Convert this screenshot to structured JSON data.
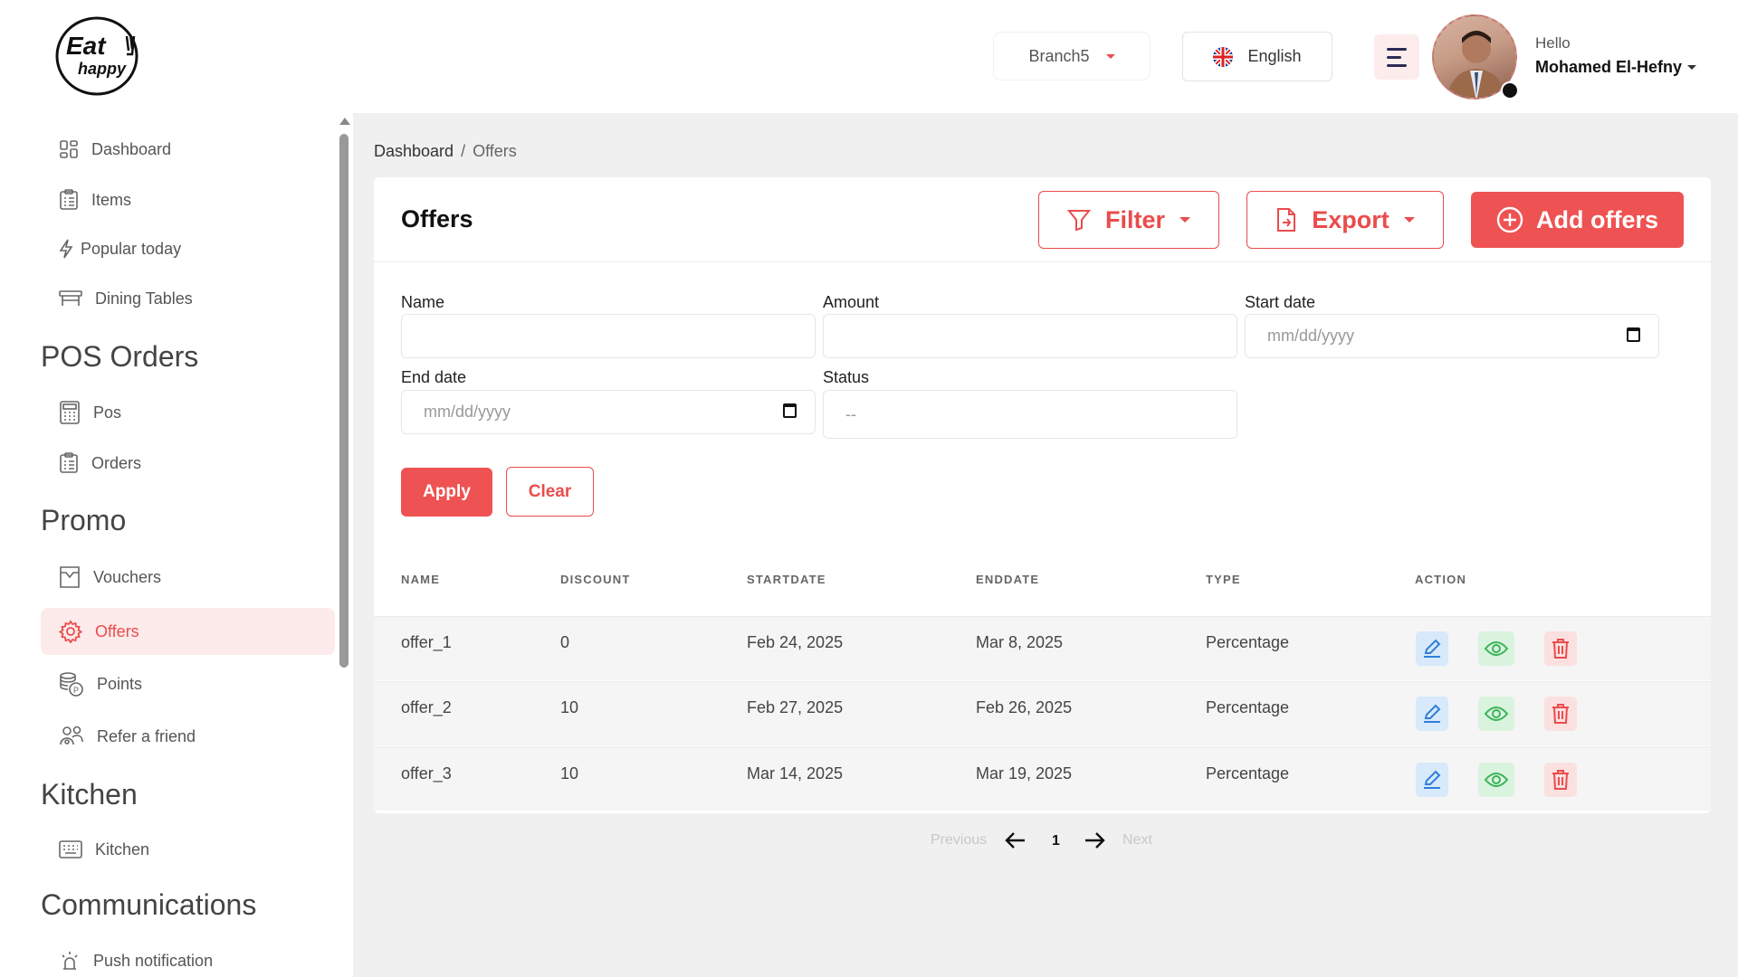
{
  "brand": {
    "logo_line1": "Eat",
    "logo_line2": "happy"
  },
  "header": {
    "branch": "Branch5",
    "language": "English",
    "greeting": "Hello",
    "user_name": "Mohamed El-Hefny"
  },
  "sidebar": {
    "items_top": [
      {
        "label": "Dashboard",
        "icon": "dashboard-icon"
      },
      {
        "label": "Items",
        "icon": "list-icon"
      },
      {
        "label": "Popular today",
        "icon": "lightning-icon"
      },
      {
        "label": "Dining Tables",
        "icon": "table-icon"
      }
    ],
    "sections": [
      {
        "title": "POS Orders",
        "items": [
          {
            "label": "Pos",
            "icon": "calculator-icon"
          },
          {
            "label": "Orders",
            "icon": "list-icon"
          }
        ]
      },
      {
        "title": "Promo",
        "items": [
          {
            "label": "Vouchers",
            "icon": "voucher-icon"
          },
          {
            "label": "Offers",
            "icon": "gear-icon",
            "active": true
          },
          {
            "label": "Points",
            "icon": "coins-icon"
          },
          {
            "label": "Refer a friend",
            "icon": "users-icon"
          }
        ]
      },
      {
        "title": "Kitchen",
        "items": [
          {
            "label": "Kitchen",
            "icon": "keyboard-icon"
          }
        ]
      },
      {
        "title": "Communications",
        "items": [
          {
            "label": "Push notification",
            "icon": "alarm-icon"
          }
        ]
      }
    ]
  },
  "breadcrumb": {
    "root": "Dashboard",
    "separator": "/",
    "current": "Offers"
  },
  "page": {
    "title": "Offers",
    "filter_label": "Filter",
    "export_label": "Export",
    "add_label": "Add offers"
  },
  "filters": {
    "name_label": "Name",
    "amount_label": "Amount",
    "start_label": "Start date",
    "start_placeholder": "mm/dd/yyyy",
    "end_label": "End date",
    "end_placeholder": "mm/dd/yyyy",
    "status_label": "Status",
    "status_value": "--",
    "apply": "Apply",
    "clear": "Clear"
  },
  "table": {
    "headers": [
      "NAME",
      "DISCOUNT",
      "STARTDATE",
      "ENDDATE",
      "TYPE",
      "ACTION"
    ],
    "rows": [
      {
        "name": "offer_1",
        "discount": "0",
        "start": "Feb 24, 2025",
        "end": "Mar 8, 2025",
        "type": "Percentage"
      },
      {
        "name": "offer_2",
        "discount": "10",
        "start": "Feb 27, 2025",
        "end": "Feb 26, 2025",
        "type": "Percentage"
      },
      {
        "name": "offer_3",
        "discount": "10",
        "start": "Mar 14, 2025",
        "end": "Mar 19, 2025",
        "type": "Percentage"
      }
    ]
  },
  "pagination": {
    "previous": "Previous",
    "page": "1",
    "next": "Next"
  },
  "colors": {
    "accent": "#ef5252",
    "accent_soft": "#fdeaea",
    "edit": "#2f7fd8",
    "view": "#3cb45a",
    "delete": "#ea4c4c"
  }
}
